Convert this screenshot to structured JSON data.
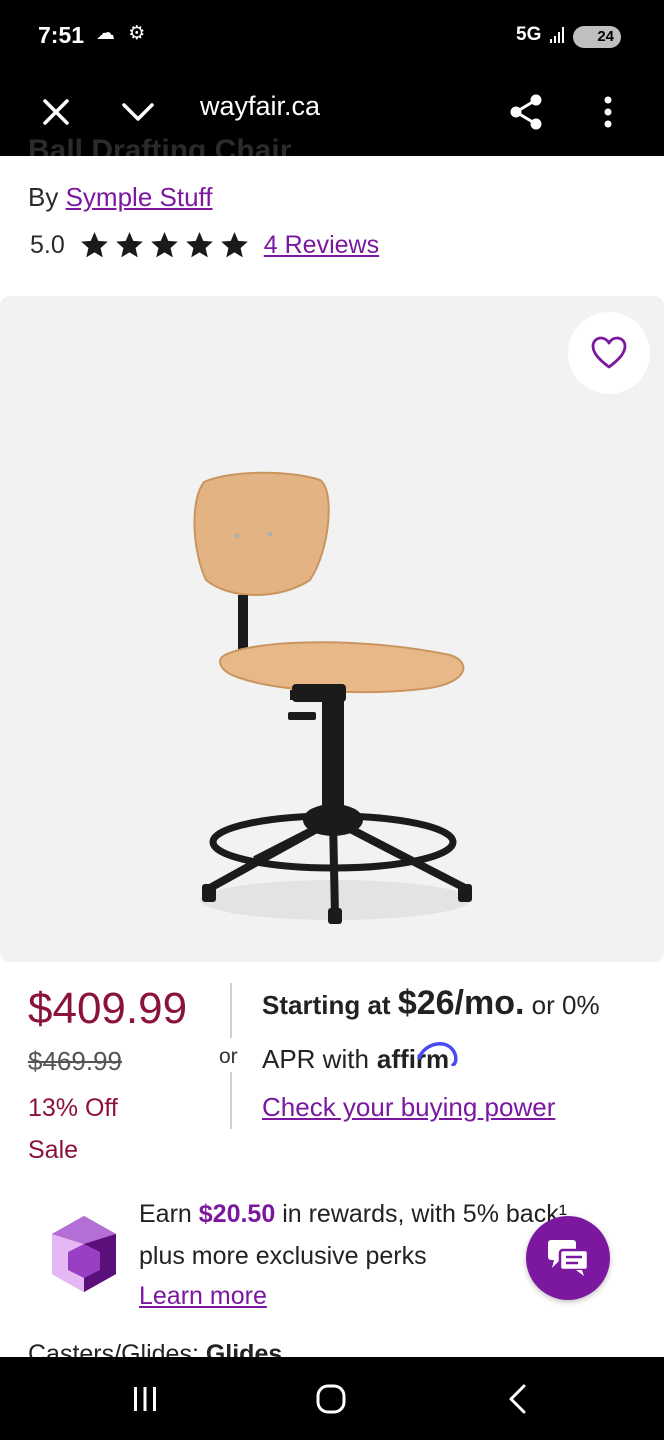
{
  "status_bar": {
    "time": "7:51",
    "left_icons": "☁ ⚙",
    "network": "5G",
    "battery": "24"
  },
  "browser": {
    "url": "wayfair.ca",
    "close_icon": "close-icon",
    "chevron_icon": "chevron-down-icon",
    "share_icon": "share-icon",
    "menu_icon": "more-vert-icon"
  },
  "product": {
    "title_partial": "Ball Drafting Chair",
    "by_prefix": "By",
    "brand": "Symple Stuff",
    "rating": "5.0",
    "star_count": 5,
    "reviews_link": "4 Reviews"
  },
  "pricing": {
    "price": "$409.99",
    "original_price": "$469.99",
    "discount": "13% Off",
    "sale_label": "Sale",
    "or": "or",
    "starting_at": "Starting at",
    "monthly": "$26/mo.",
    "or_apr": "or 0%",
    "apr_with": "APR with",
    "affirm": "affirm",
    "buying_power": "Check your buying power"
  },
  "rewards": {
    "earn": "Earn",
    "amount": "$20.50",
    "rest": "in rewards, with 5% back¹,",
    "line2": "plus more exclusive perks",
    "learn_more": "Learn more"
  },
  "specs": {
    "casters_label": "Casters/Glides:",
    "casters_value": "Glides"
  },
  "colors": {
    "brand_purple": "#7b189f",
    "sale_red": "#8b1238"
  }
}
